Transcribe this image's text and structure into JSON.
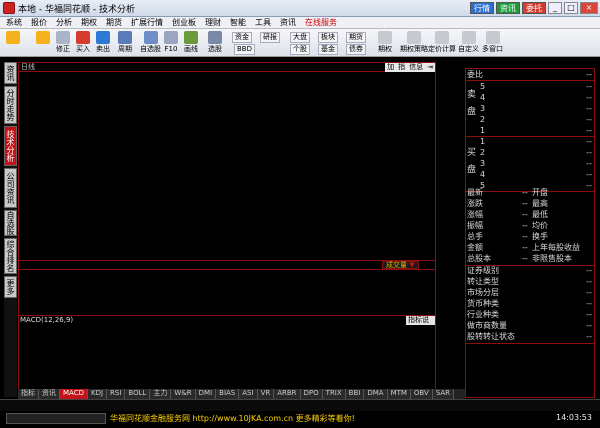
{
  "window": {
    "title": "本地 - 华福同花顺 - 技术分析",
    "btn_trade": "行情",
    "btn_info": "资讯",
    "btn_order": "委托"
  },
  "menu": [
    "系统",
    "报价",
    "分析",
    "期权",
    "期货",
    "扩展行情",
    "创业板",
    "理财",
    "智能",
    "工具",
    "资讯",
    "在线服务"
  ],
  "toolbar": {
    "tools": [
      {
        "label": "",
        "color": "#f5b21c"
      },
      {
        "label": "",
        "color": "#f5b21c"
      },
      {
        "label": "修正",
        "color": "#aab4c8"
      },
      {
        "label": "买入",
        "color": "#d43b2d"
      },
      {
        "label": "卖出",
        "color": "#2c7ad6"
      },
      {
        "label": "周期",
        "color": "#5b7bb9"
      },
      {
        "label": "自选股",
        "color": "#6f8ec7"
      },
      {
        "label": "F10",
        "color": "#9aa6c0"
      },
      {
        "label": "画线",
        "color": "#6a9a3a"
      },
      {
        "label": "选股",
        "color": "#7a88aa"
      },
      {
        "label": "期权",
        "color": "#c8c8d0"
      },
      {
        "label": "期权策略",
        "color": "#c8c8d0"
      },
      {
        "label": "定价计算",
        "color": "#c8c8d0"
      },
      {
        "label": "自定义",
        "color": "#c8c8d0"
      },
      {
        "label": "多窗口",
        "color": "#c8c8d0"
      }
    ],
    "pills": [
      "资金",
      "研报",
      "大盘",
      "板块",
      "期货",
      "BBD",
      "个股",
      "基金",
      "债券"
    ]
  },
  "left_tabs": [
    "资讯",
    "分时走势",
    "技术分析",
    "公司资讯",
    "自选股",
    "综合排名",
    "更多"
  ],
  "chart": {
    "period_label": "日线",
    "top_buttons": [
      "加",
      "指",
      "信息"
    ],
    "volume_tag": "成交量",
    "macd_label": "MACD(12,26,9)",
    "index_explain": "指标说明"
  },
  "right_panel": {
    "commission_label": "委比",
    "sell_label": "卖盘",
    "buy_label": "买盘",
    "levels": [
      "5",
      "4",
      "3",
      "2",
      "1"
    ],
    "buy_levels": [
      "1",
      "2",
      "3",
      "4",
      "5"
    ],
    "dash": "--",
    "stats_left": [
      "最新",
      "涨跌",
      "涨幅",
      "振幅",
      "总手",
      "金额",
      "总股本"
    ],
    "stats_right": [
      "开盘",
      "最高",
      "最低",
      "均价",
      "换手",
      "上年每股收益",
      "非限售股本"
    ],
    "info_rows": [
      "证券级别",
      "转让类型",
      "市场分层",
      "货币种类",
      "行业种类",
      "做市商数量",
      "股转转让状态"
    ]
  },
  "bottom_tabs": [
    "指标",
    "资讯",
    "MACD",
    "KDJ",
    "RSI",
    "BOLL",
    "主力",
    "W&R",
    "DMI",
    "BIAS",
    "ASI",
    "VR",
    "ARBR",
    "DPO",
    "TRIX",
    "BBI",
    "DMA",
    "MTM",
    "OBV",
    "SAR"
  ],
  "active_bottom_tab": "MACD",
  "status": {
    "ticker": "华福同花顺金融服务网  http://www.10JKA.com.cn   更多精彩等着你!",
    "clock": "14:03:53"
  },
  "colors": {
    "accent": "#c0141a",
    "grid": "#8a1010"
  }
}
